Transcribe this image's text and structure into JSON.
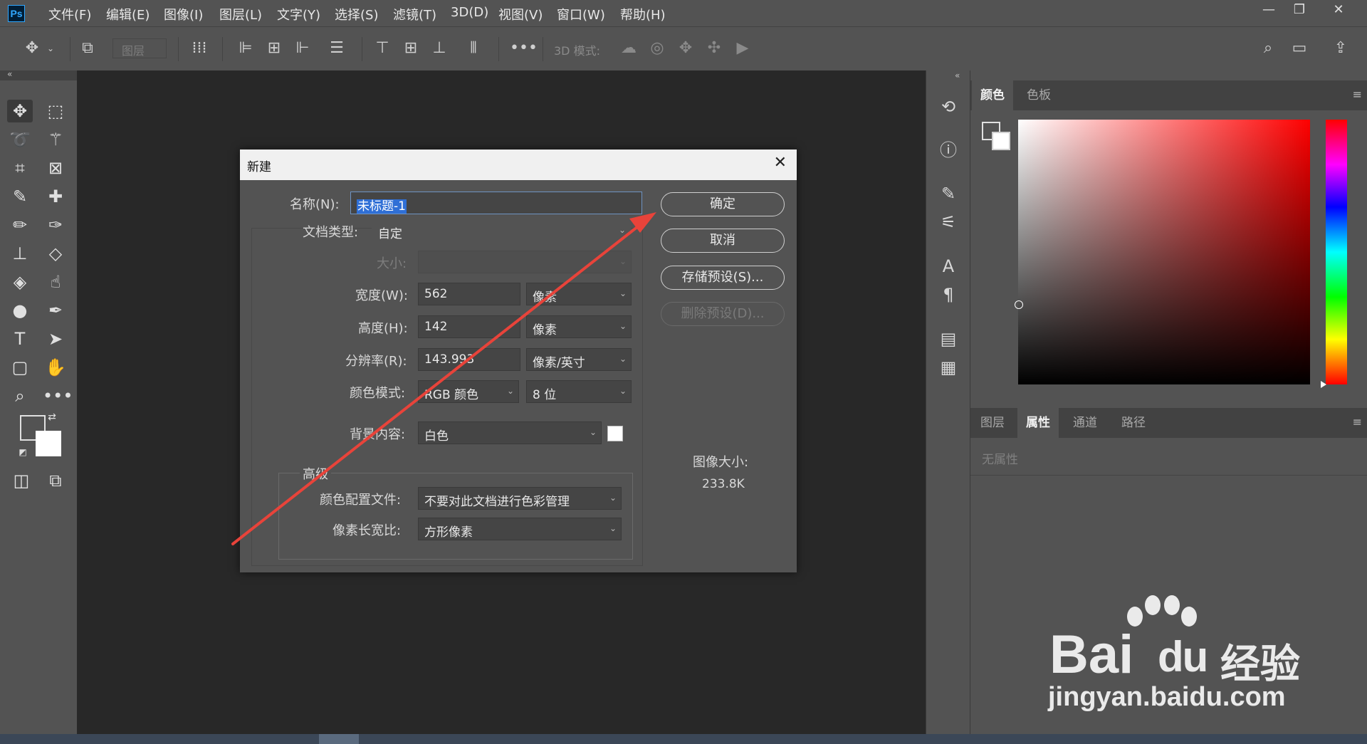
{
  "app": {
    "logo": "Ps",
    "menu": [
      "文件(F)",
      "编辑(E)",
      "图像(I)",
      "图层(L)",
      "文字(Y)",
      "选择(S)",
      "滤镜(T)",
      "3D(D)",
      "视图(V)",
      "窗口(W)",
      "帮助(H)"
    ],
    "window_controls": [
      "minimize-icon",
      "restore-icon",
      "close-icon"
    ]
  },
  "options_bar": {
    "layer_select": "图层",
    "label_3d": "3D 模式:",
    "more": "•••"
  },
  "right_panels": {
    "color_tabs": [
      "颜色",
      "色板"
    ],
    "color_active_tab": "颜色",
    "props_tabs": [
      "图层",
      "属性",
      "通道",
      "路径"
    ],
    "props_active_tab": "属性",
    "props_empty": "无属性"
  },
  "dialog": {
    "title": "新建",
    "name_label": "名称(N):",
    "name_value": "未标题-1",
    "doctype_label": "文档类型:",
    "doctype_value": "自定",
    "size_label": "大小:",
    "size_value": "",
    "width_label": "宽度(W):",
    "width_value": "562",
    "width_unit": "像素",
    "height_label": "高度(H):",
    "height_value": "142",
    "height_unit": "像素",
    "resolution_label": "分辨率(R):",
    "resolution_value": "143.993",
    "resolution_unit": "像素/英寸",
    "colormode_label": "颜色模式:",
    "colormode_value": "RGB 颜色",
    "bitdepth_value": "8 位",
    "bg_label": "背景内容:",
    "bg_value": "白色",
    "bg_swatch": "#ffffff",
    "advanced_label": "高级",
    "profile_label": "颜色配置文件:",
    "profile_value": "不要对此文档进行色彩管理",
    "pixel_aspect_label": "像素长宽比:",
    "pixel_aspect_value": "方形像素",
    "ok_button": "确定",
    "cancel_button": "取消",
    "save_preset_button": "存储预设(S)...",
    "delete_preset_button": "删除预设(D)...",
    "image_size_label": "图像大小:",
    "image_size_value": "233.8K"
  },
  "watermark": {
    "brand": "Bai",
    "brand_suffix": "经验",
    "url": "jingyan.baidu.com"
  },
  "annotation_color": "#e8433a"
}
